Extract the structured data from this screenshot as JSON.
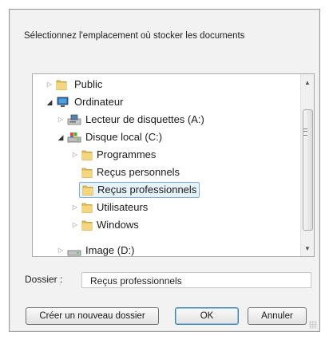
{
  "dialog": {
    "instruction": "Sélectionnez l'emplacement où stocker les documents"
  },
  "tree": {
    "items": [
      {
        "label": "Public",
        "icon": "folder-icon",
        "expander": "collapsed"
      },
      {
        "label": "Ordinateur",
        "icon": "computer-icon",
        "expander": "expanded"
      },
      {
        "label": "Lecteur de disquettes (A:)",
        "icon": "floppy-drive-icon",
        "expander": "collapsed"
      },
      {
        "label": "Disque local (C:)",
        "icon": "hard-drive-icon",
        "expander": "expanded"
      },
      {
        "label": "Programmes",
        "icon": "folder-icon",
        "expander": "collapsed"
      },
      {
        "label": "Reçus personnels",
        "icon": "folder-icon",
        "expander": "none"
      },
      {
        "label": "Reçus professionnels",
        "icon": "folder-icon",
        "expander": "none",
        "selected": true
      },
      {
        "label": "Utilisateurs",
        "icon": "folder-icon",
        "expander": "collapsed"
      },
      {
        "label": "Windows",
        "icon": "folder-icon",
        "expander": "collapsed"
      },
      {
        "label": "Image (D:)",
        "icon": "drive-icon",
        "expander": "collapsed"
      }
    ]
  },
  "folder_field": {
    "label": "Dossier :",
    "value": "Reçus professionnels"
  },
  "buttons": {
    "new_folder": "Créer un nouveau dossier",
    "ok": "OK",
    "cancel": "Annuler"
  },
  "colors": {
    "selection_bg": "#e5f3fb",
    "selection_border": "#84acdd",
    "folder": "#e8c25a"
  }
}
